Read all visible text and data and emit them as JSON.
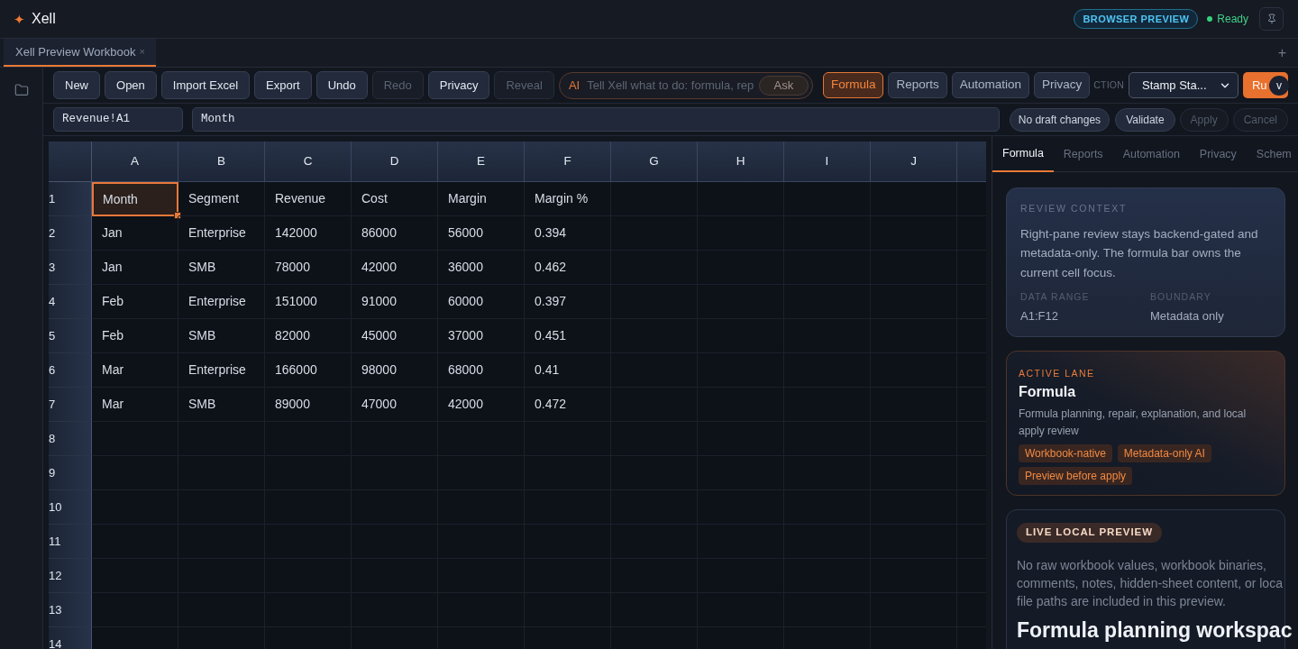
{
  "app": {
    "logo": "✦",
    "title": "Xell",
    "badge": "BROWSER PREVIEW",
    "status": "Ready"
  },
  "workbook_tabs": [
    {
      "label": "Xell Preview Workbook",
      "close": "×",
      "selected": true
    }
  ],
  "new_tab": "+",
  "toolbar": {
    "buttons": [
      {
        "label": "New",
        "disabled": false
      },
      {
        "label": "Open",
        "disabled": false
      },
      {
        "label": "Import Excel",
        "disabled": false
      },
      {
        "label": "Export",
        "disabled": false
      },
      {
        "label": "Undo",
        "disabled": false
      },
      {
        "label": "Redo",
        "disabled": true
      },
      {
        "label": "Privacy",
        "disabled": false
      },
      {
        "label": "Reveal",
        "disabled": true
      }
    ],
    "ai": {
      "label": "AI",
      "placeholder": "Tell Xell what to do: formula, rep",
      "button": "Ask"
    },
    "lanes": [
      {
        "label": "Formula",
        "selected": true
      },
      {
        "label": "Reports",
        "selected": false
      },
      {
        "label": "Automation",
        "selected": false
      },
      {
        "label": "Privacy",
        "selected": false
      }
    ],
    "action_label": "CTION",
    "action_select": {
      "value": "Stamp Sta..."
    },
    "run_button": "Ru",
    "version_badge": "v"
  },
  "formula_bar": {
    "name_box": "Revenue!A1",
    "value": "Month",
    "draft_status": "No draft changes",
    "buttons": [
      {
        "label": "Validate",
        "disabled": false
      },
      {
        "label": "Apply",
        "disabled": true
      },
      {
        "label": "Cancel",
        "disabled": true
      }
    ]
  },
  "sheet": {
    "columns": [
      "A",
      "B",
      "C",
      "D",
      "E",
      "F",
      "G",
      "H",
      "I",
      "J"
    ],
    "rows": [
      {
        "label": "1",
        "cells": [
          {
            "text": "Month",
            "selected": true
          },
          {
            "text": "Segment",
            "selected": false
          },
          {
            "text": "Revenue",
            "selected": false
          },
          {
            "text": "Cost",
            "selected": false
          },
          {
            "text": "Margin",
            "selected": false
          },
          {
            "text": "Margin %",
            "selected": false
          }
        ]
      },
      {
        "label": "2",
        "cells": [
          {
            "text": "Jan",
            "selected": false
          },
          {
            "text": "Enterprise",
            "selected": false
          },
          {
            "text": "142000",
            "selected": false
          },
          {
            "text": "86000",
            "selected": false
          },
          {
            "text": "56000",
            "selected": false
          },
          {
            "text": "0.394",
            "selected": false
          }
        ]
      },
      {
        "label": "3",
        "cells": [
          {
            "text": "Jan",
            "selected": false
          },
          {
            "text": "SMB",
            "selected": false
          },
          {
            "text": "78000",
            "selected": false
          },
          {
            "text": "42000",
            "selected": false
          },
          {
            "text": "36000",
            "selected": false
          },
          {
            "text": "0.462",
            "selected": false
          }
        ]
      },
      {
        "label": "4",
        "cells": [
          {
            "text": "Feb",
            "selected": false
          },
          {
            "text": "Enterprise",
            "selected": false
          },
          {
            "text": "151000",
            "selected": false
          },
          {
            "text": "91000",
            "selected": false
          },
          {
            "text": "60000",
            "selected": false
          },
          {
            "text": "0.397",
            "selected": false
          }
        ]
      },
      {
        "label": "5",
        "cells": [
          {
            "text": "Feb",
            "selected": false
          },
          {
            "text": "SMB",
            "selected": false
          },
          {
            "text": "82000",
            "selected": false
          },
          {
            "text": "45000",
            "selected": false
          },
          {
            "text": "37000",
            "selected": false
          },
          {
            "text": "0.451",
            "selected": false
          }
        ]
      },
      {
        "label": "6",
        "cells": [
          {
            "text": "Mar",
            "selected": false
          },
          {
            "text": "Enterprise",
            "selected": false
          },
          {
            "text": "166000",
            "selected": false
          },
          {
            "text": "98000",
            "selected": false
          },
          {
            "text": "68000",
            "selected": false
          },
          {
            "text": "0.41",
            "selected": false
          }
        ]
      },
      {
        "label": "7",
        "cells": [
          {
            "text": "Mar",
            "selected": false
          },
          {
            "text": "SMB",
            "selected": false
          },
          {
            "text": "89000",
            "selected": false
          },
          {
            "text": "47000",
            "selected": false
          },
          {
            "text": "42000",
            "selected": false
          },
          {
            "text": "0.472",
            "selected": false
          }
        ]
      },
      {
        "label": "8"
      },
      {
        "label": "9"
      },
      {
        "label": "10"
      },
      {
        "label": "11"
      },
      {
        "label": "12"
      },
      {
        "label": "13"
      },
      {
        "label": "14"
      }
    ]
  },
  "side_panel": {
    "tabs": [
      {
        "label": "Formula",
        "selected": true
      },
      {
        "label": "Reports",
        "selected": false
      },
      {
        "label": "Automation",
        "selected": false
      },
      {
        "label": "Privacy",
        "selected": false
      },
      {
        "label": "Schem",
        "selected": false
      }
    ],
    "review_context": {
      "heading": "REVIEW CONTEXT",
      "text": "Right-pane review stays backend-gated and metadata-only. The formula bar owns the current cell focus.",
      "facts": [
        {
          "label": "DATA RANGE",
          "value": "A1:F12"
        },
        {
          "label": "BOUNDARY",
          "value": "Metadata only"
        }
      ]
    },
    "active_lane": {
      "heading": "ACTIVE LANE",
      "title": "Formula",
      "text": "Formula planning, repair, explanation, and local apply review",
      "tags": [
        "Workbook-native",
        "Metadata-only AI",
        "Preview before apply"
      ]
    },
    "live_preview": {
      "pill": "LIVE LOCAL PREVIEW",
      "lines": [
        "No raw workbook values, workbook binaries,",
        "comments, notes, hidden-sheet content, or loca",
        "file paths are included in this preview."
      ],
      "title": "Formula planning workspac"
    }
  }
}
